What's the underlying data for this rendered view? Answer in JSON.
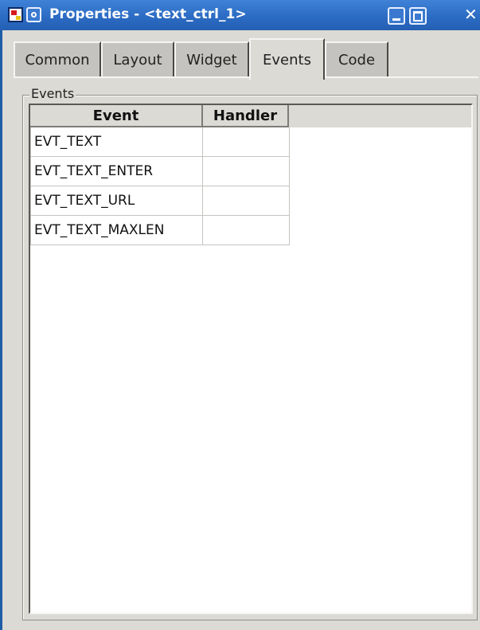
{
  "window": {
    "title": "Properties - <text_ctrl_1>",
    "icons": [
      "app-icon",
      "window-menu-icon",
      "minimize-icon",
      "maximize-icon",
      "close-icon"
    ],
    "close_glyph": "✕"
  },
  "tabs": [
    {
      "label": "Common",
      "active": false
    },
    {
      "label": "Layout",
      "active": false
    },
    {
      "label": "Widget",
      "active": false
    },
    {
      "label": "Events",
      "active": true
    },
    {
      "label": "Code",
      "active": false
    }
  ],
  "events_group": {
    "label": "Events",
    "columns": [
      "Event",
      "Handler"
    ],
    "rows": [
      {
        "event": "EVT_TEXT",
        "handler": ""
      },
      {
        "event": "EVT_TEXT_ENTER",
        "handler": ""
      },
      {
        "event": "EVT_TEXT_URL",
        "handler": ""
      },
      {
        "event": "EVT_TEXT_MAXLEN",
        "handler": ""
      }
    ]
  },
  "colors": {
    "titlebar": "#2c6cc4",
    "panel": "#dcdad5",
    "grid_bg": "#ffffff"
  }
}
